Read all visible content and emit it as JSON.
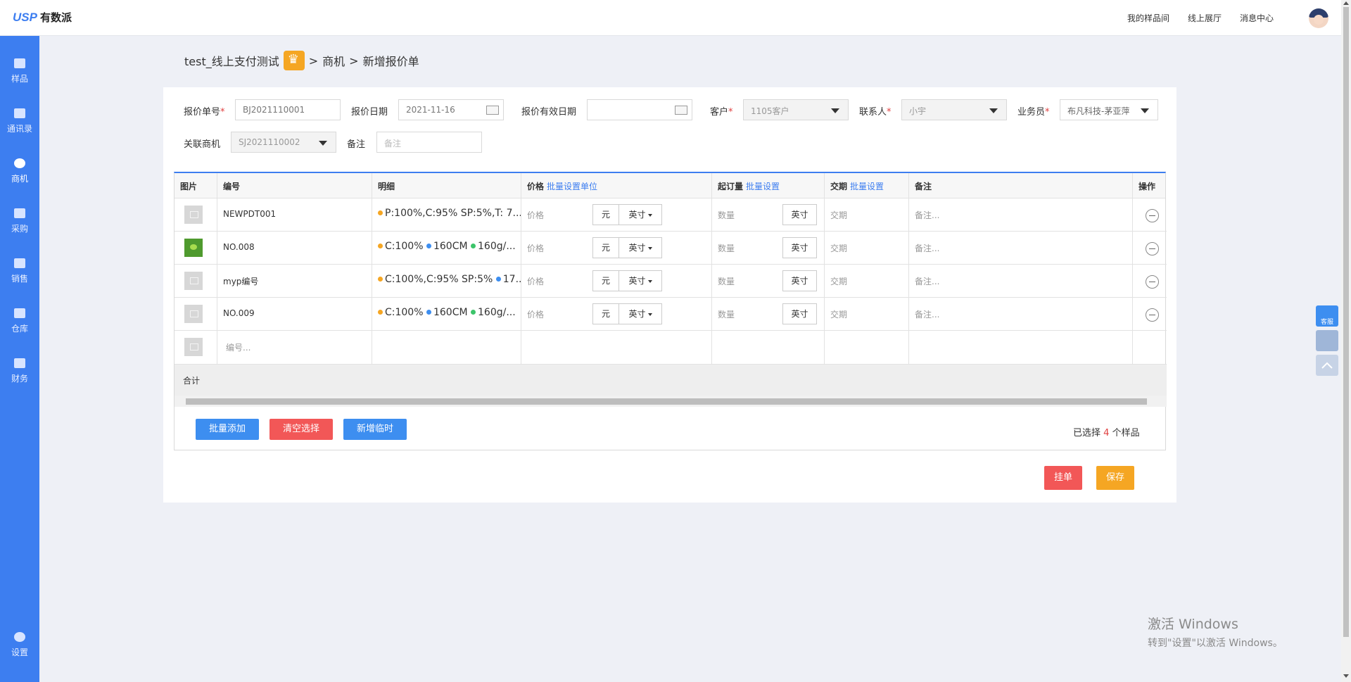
{
  "topbar": {
    "logo_usp": "USP",
    "logo_name": "有数派",
    "nav": [
      "我的样品间",
      "线上展厅",
      "消息中心"
    ]
  },
  "sidebar": {
    "items": [
      {
        "label": "样品",
        "icon": "sample-icon"
      },
      {
        "label": "通讯录",
        "icon": "contacts-icon"
      },
      {
        "label": "商机",
        "icon": "opportunity-icon",
        "active": true
      },
      {
        "label": "采购",
        "icon": "purchase-icon"
      },
      {
        "label": "销售",
        "icon": "sales-icon"
      },
      {
        "label": "仓库",
        "icon": "warehouse-icon"
      },
      {
        "label": "财务",
        "icon": "finance-icon"
      }
    ],
    "settings_label": "设置"
  },
  "breadcrumb": {
    "company": "test_线上支付测试",
    "sep": ">",
    "section": "商机",
    "page": "新增报价单"
  },
  "form": {
    "quote_no_label": "报价单号",
    "quote_no_value": "BJ2021110001",
    "quote_date_label": "报价日期",
    "quote_date_value": "2021-11-16",
    "valid_date_label": "报价有效日期",
    "valid_date_value": "",
    "customer_label": "客户",
    "customer_value": "1105客户",
    "contact_label": "联系人",
    "contact_value": "小宇",
    "salesman_label": "业务员",
    "salesman_value": "布凡科技-茅亚萍",
    "related_label": "关联商机",
    "related_value": "SJ2021110002",
    "remark_label": "备注",
    "remark_placeholder": "备注",
    "required_mark": "*"
  },
  "table": {
    "headers": {
      "image": "图片",
      "code": "编号",
      "detail": "明细",
      "price": "价格",
      "price_link": "批量设置单位",
      "moq": "起订量",
      "moq_link": "批量设置",
      "lead": "交期",
      "lead_link": "批量设置",
      "remark": "备注",
      "action": "操作"
    },
    "rows": [
      {
        "code": "NEWPDT001",
        "detail": [
          {
            "text": "P:100%,C:95% SP:5%,T: 7...",
            "color": "#f5a623"
          }
        ],
        "thumb": "placeholder"
      },
      {
        "code": "NO.008",
        "detail": [
          {
            "text": "C:100%",
            "color": "#f5a623"
          },
          {
            "text": "160CM",
            "color": "#3d8ef0"
          },
          {
            "text": "160g/...",
            "color": "#3cc46a"
          }
        ],
        "thumb": "green"
      },
      {
        "code": "myp编号",
        "detail": [
          {
            "text": "C:100%,C:95% SP:5%",
            "color": "#f5a623"
          },
          {
            "text": "17...",
            "color": "#3d8ef0"
          }
        ],
        "thumb": "placeholder"
      },
      {
        "code": "NO.009",
        "detail": [
          {
            "text": "C:100%",
            "color": "#f5a623"
          },
          {
            "text": "160CM",
            "color": "#3d8ef0"
          },
          {
            "text": "160g/...",
            "color": "#3cc46a"
          }
        ],
        "thumb": "placeholder"
      }
    ],
    "price_placeholder": "价格",
    "currency": "元",
    "unit": "英寸",
    "qty_placeholder": "数量",
    "lead_placeholder": "交期",
    "remark_placeholder": "备注...",
    "code_placeholder": "编号...",
    "total_label": "合计"
  },
  "actions": {
    "batch_add": "批量添加",
    "clear": "清空选择",
    "add_temp": "新增临时",
    "selected_prefix": "已选择",
    "selected_count": "4",
    "selected_suffix": "个样品",
    "hold": "挂单",
    "save": "保存"
  },
  "float": {
    "service": "客服"
  },
  "watermark": {
    "line1": "激活 Windows",
    "line2": "转到\"设置\"以激活 Windows。"
  }
}
